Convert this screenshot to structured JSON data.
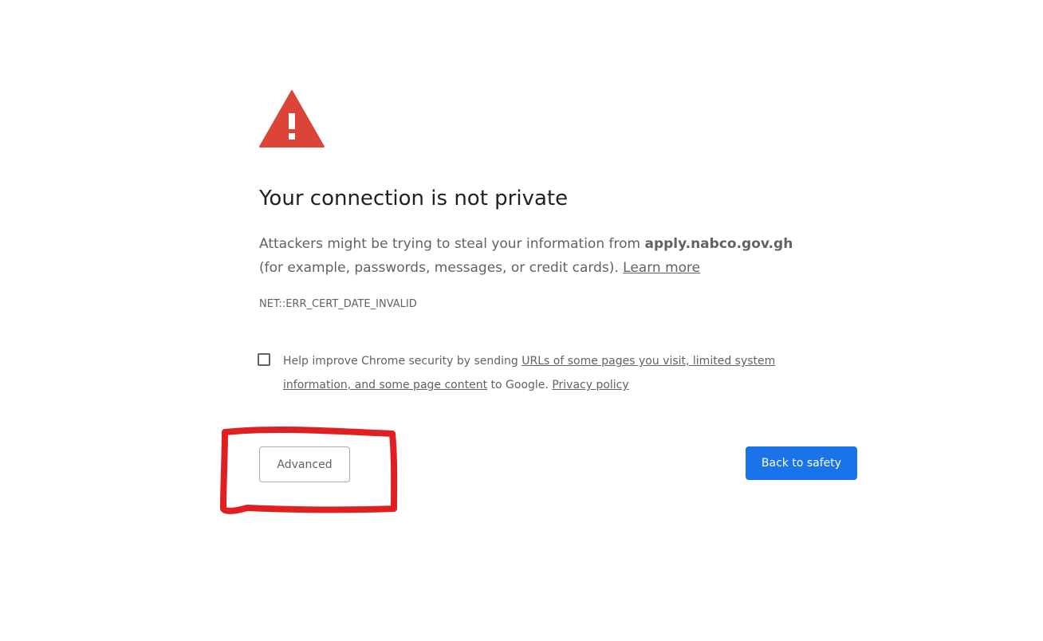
{
  "page": {
    "title": "Your connection is not private",
    "message_part1": "Attackers might be trying to steal your information from ",
    "domain": "apply.nabco.gov.gh",
    "message_part2": " (for example, passwords, messages, or credit cards). ",
    "learn_more": "Learn more",
    "error_code": "NET::ERR_CERT_DATE_INVALID"
  },
  "optin": {
    "text1": "Help improve Chrome security by sending ",
    "link1": "URLs of some pages you visit, limited system information, and some page content",
    "text2": " to Google. ",
    "link2": "Privacy policy",
    "checked": false
  },
  "buttons": {
    "advanced": "Advanced",
    "back_to_safety": "Back to safety"
  },
  "colors": {
    "warning_icon": "#db4437",
    "primary_button": "#1a73e8",
    "annotation": "#e02020"
  },
  "icons": {
    "warning": "warning-triangle-icon"
  }
}
